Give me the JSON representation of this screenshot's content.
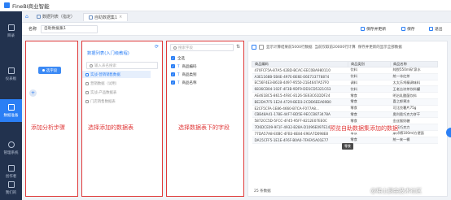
{
  "app": {
    "title": "FineBI商业智能"
  },
  "nav": [
    {
      "label": "目录"
    },
    {
      "label": "仪表板"
    },
    {
      "label": "数据准备",
      "active": true
    },
    {
      "label": "管理系统"
    },
    {
      "label": "创作者"
    },
    {
      "label": "我们的"
    }
  ],
  "tabs": [
    {
      "label": "数据列表（指定）"
    },
    {
      "label": "自助数据集1",
      "active": true
    }
  ],
  "toolbar": {
    "name_label": "名称",
    "name_value": "自助数据集1",
    "save_update": "保存并更新",
    "save": "保存",
    "cancel": "退出"
  },
  "steps_panel": {
    "button": "选字段",
    "annotation": "添加分析步骤"
  },
  "source_panel": {
    "title": "数据列表(入门级教程)",
    "search_placeholder": "输入表名搜索",
    "items": [
      "实战-营销销售数据",
      "营销数据（试用）",
      "实战-产品数据表",
      "门店销售数据表"
    ],
    "annotation": "选择添加的数据表"
  },
  "field_panel": {
    "search_placeholder": "搜索字段",
    "select_all": "全选",
    "fields": [
      "商品编码",
      "商品类别",
      "商品名称"
    ],
    "annotation": "选择数据表下的字段"
  },
  "data_panel": {
    "info_preview": "显示计算结果前5000行数据",
    "info_limit": "当前仅取前20000行计算",
    "info_save": "保存并更新的显示全部数据",
    "columns": [
      "商品编码",
      "商品类别",
      "商品名称"
    ],
    "rows": [
      [
        "470FCF5A-87A5-42BD-BCAC-EEC0BA980110",
        "饮料",
        "纯悦550ml矿泉水"
      ],
      [
        "A3E1168B-5B4E-497E-BE6E-E6E733778874",
        "饮料",
        "统一冰红茶"
      ],
      [
        "EC56F4E3-B61B-4497-9550-21E4647A57F0",
        "调料",
        "太太乐鸡精调味料"
      ],
      [
        "6836CB04-102F-4F3B-9DF9-DD1CD5321C63",
        "饮料",
        "王老吉凉茶饮料罐"
      ],
      [
        "AE461BC5-8615-4F8C-8126-5E63C61DDF24",
        "零食",
        "明治乳酸菌饮料"
      ],
      [
        "BE2DA7F5-1E24-4729-BED3-2CDD6EEA69B0",
        "零食",
        "喜之郎果冻"
      ],
      [
        "E2CF5CFA-1E86-4660-B7CA-F077A8...",
        "零食",
        "可比克薯片75g"
      ],
      [
        "CBB48A41-178E-44F7-BD5E-9ECCB873478A",
        "零食",
        "奥利奥巧克力饼干"
      ],
      [
        "5872CC5D-5FCC-4F45-95FF-8212E07EE0C",
        "零食",
        "金丝猴奶糖"
      ],
      [
        "7D6DCE09-9F1F-4932-B28A-D1096E097E14",
        "零食",
        "德芙巧克力"
      ],
      [
        "77DA57A8-E0BC-4FB3-8E84-E9EA7D098E8",
        "零食",
        "康师傅100ml方便面"
      ],
      [
        "DA15CFF5-1E1E-4F6F-B0A0-7FAFA5A01E77",
        "零食",
        "统一来一桶"
      ]
    ],
    "annotation": "预览自助数据集添加的数据",
    "tooltip": "零食",
    "total_count": "25 条数据"
  },
  "watermark": "@稀土掘金技术社区"
}
